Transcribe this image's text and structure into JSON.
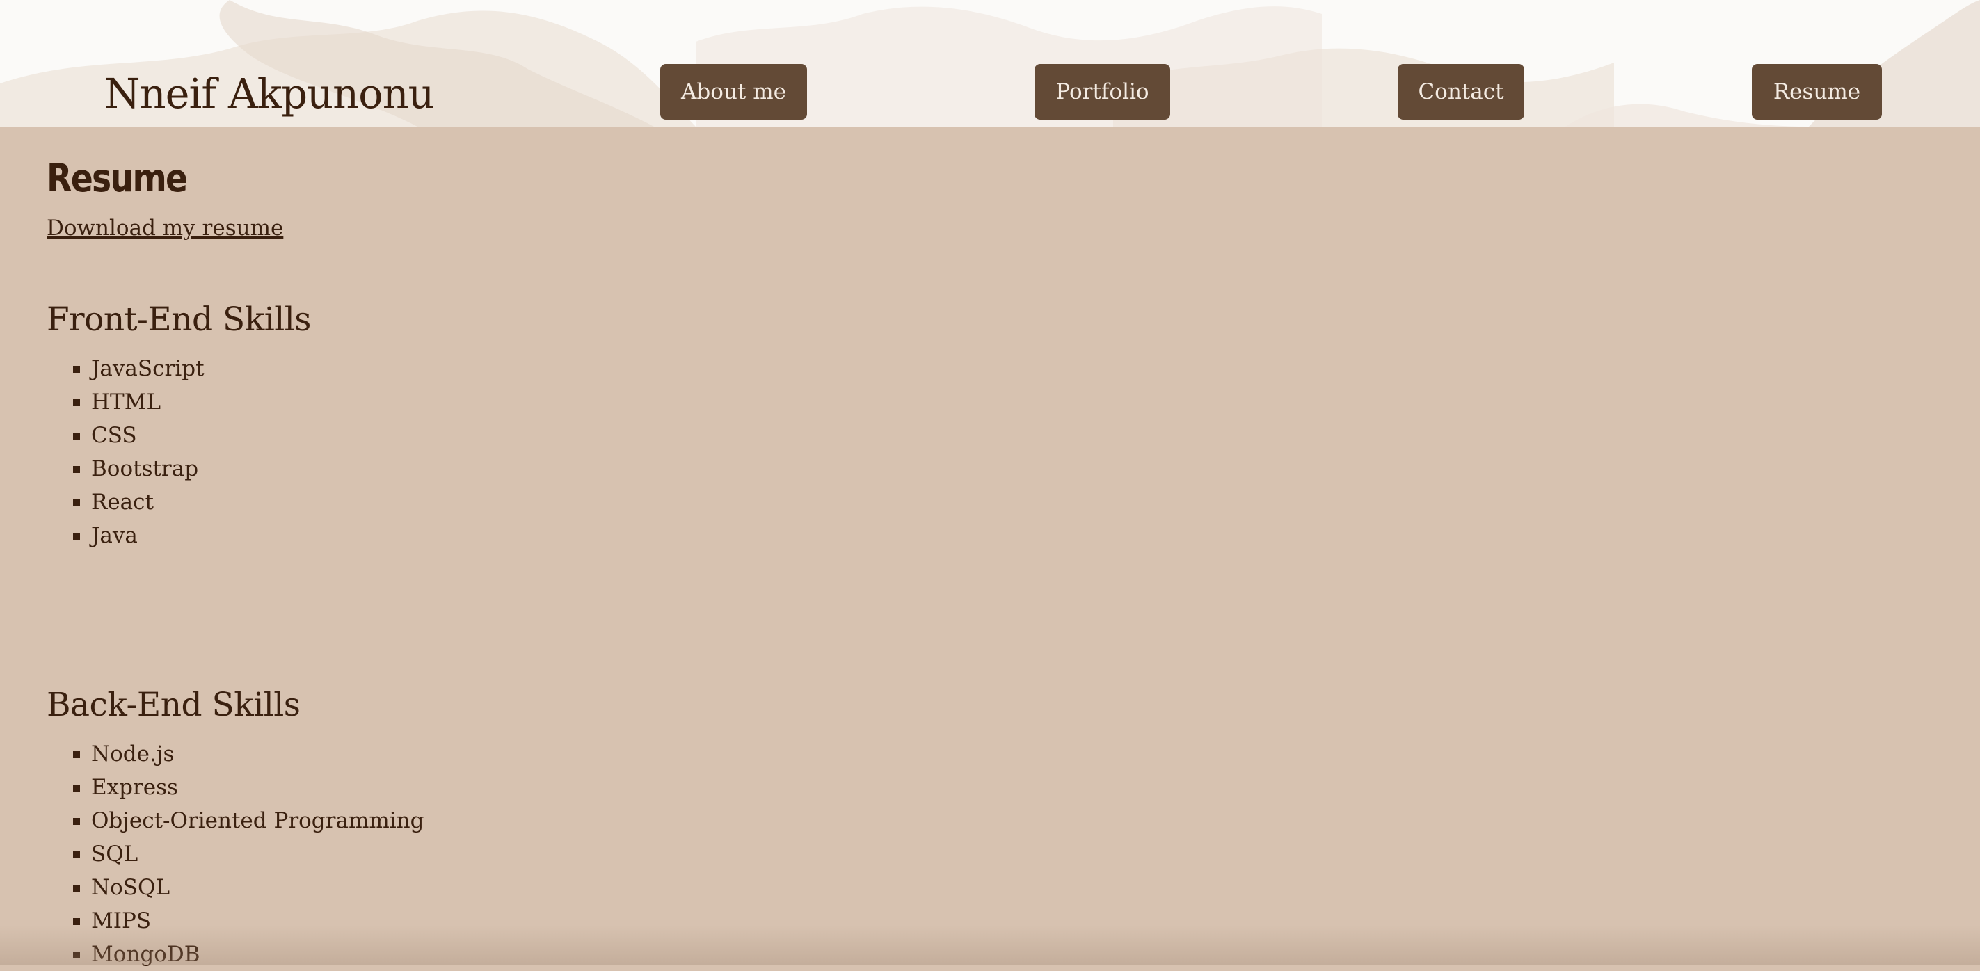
{
  "header": {
    "site_name": "Nneif Akpunonu",
    "nav": {
      "about": "About me",
      "portfolio": "Portfolio",
      "contact": "Contact",
      "resume": "Resume"
    }
  },
  "main": {
    "title": "Resume",
    "download_link": "Download my resume",
    "front_end": {
      "heading": "Front-End Skills",
      "skills": [
        "JavaScript",
        "HTML",
        "CSS",
        "Bootstrap",
        "React",
        "Java"
      ]
    },
    "back_end": {
      "heading": "Back-End Skills",
      "skills": [
        "Node.js",
        "Express",
        "Object-Oriented Programming",
        "SQL",
        "NoSQL",
        "MIPS",
        "MongoDB"
      ]
    }
  },
  "colors": {
    "page_background": "#d7c2b0",
    "header_background": "#fbfaf8",
    "button_background": "#634a36",
    "button_text": "#f4ebe2",
    "text": "#3a200f"
  },
  "icons": {
    "list_bullet": "square-bullet-icon"
  }
}
